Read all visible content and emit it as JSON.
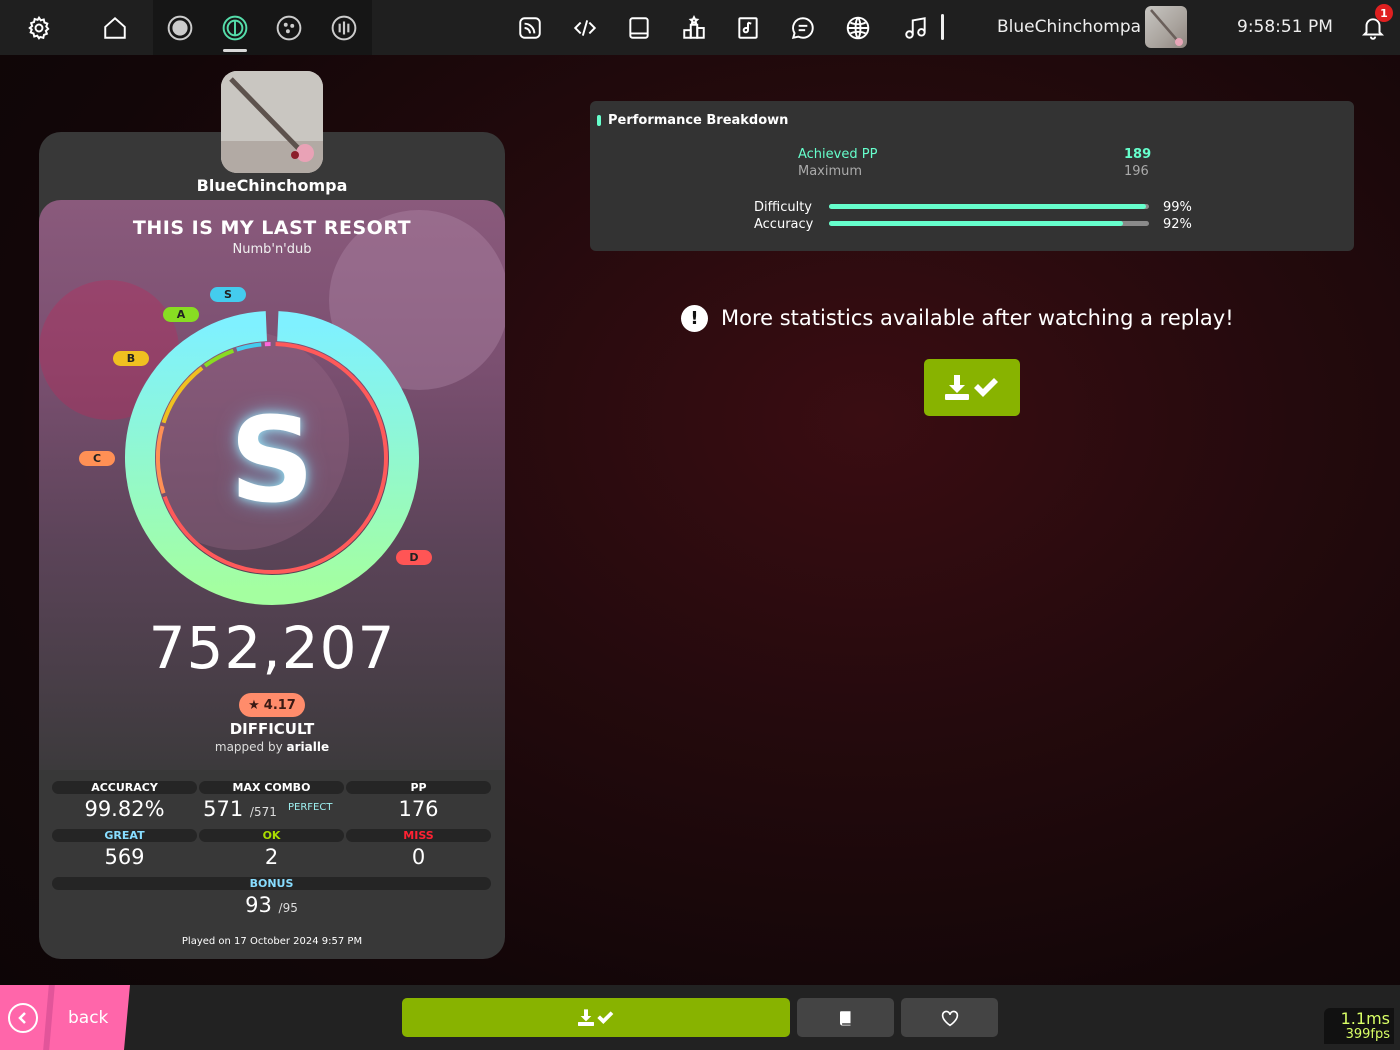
{
  "toolbar": {
    "username": "BlueChinchompa",
    "clock": "9:58:51 PM",
    "notification_count": "1",
    "icons": [
      "settings-icon",
      "home-icon",
      "ruleset-osu-icon",
      "ruleset-taiko-icon",
      "ruleset-catch-icon",
      "ruleset-mania-icon",
      "beatmap-listing-icon",
      "code-icon",
      "wiki-icon",
      "rankings-icon",
      "changelog-icon",
      "chat-icon",
      "dashboard-icon",
      "now-playing-icon",
      "notifications-icon"
    ]
  },
  "score": {
    "username": "BlueChinchompa",
    "title": "THIS IS MY LAST RESORT",
    "artist": "Numb'n'dub",
    "rank": "S",
    "total_score": "752,207",
    "star_rating": "4.17",
    "difficulty": "DIFFICULT",
    "mapped_by_prefix": "mapped by",
    "mapper": "arialle",
    "accuracy_fraction": 0.9982,
    "grade_labels": {
      "s": "S",
      "a": "A",
      "b": "B",
      "c": "C",
      "d": "D"
    },
    "stats": {
      "accuracy": {
        "label": "ACCURACY",
        "value": "99.82%"
      },
      "max_combo": {
        "label": "MAX COMBO",
        "value": "571",
        "max": "/571",
        "tag": "PERFECT"
      },
      "pp": {
        "label": "PP",
        "value": "176"
      },
      "great": {
        "label": "GREAT",
        "value": "569"
      },
      "ok": {
        "label": "OK",
        "value": "2"
      },
      "miss": {
        "label": "MISS",
        "value": "0"
      },
      "bonus": {
        "label": "BONUS",
        "value": "93",
        "max": "/95"
      }
    },
    "played_on": "Played on 17 October 2024 9:57 PM"
  },
  "performance": {
    "title": "Performance Breakdown",
    "achieved_label": "Achieved PP",
    "achieved_value": "189",
    "maximum_label": "Maximum",
    "maximum_value": "196",
    "difficulty_label": "Difficulty",
    "difficulty_value": "99%",
    "difficulty_fraction": 0.99,
    "accuracy_label": "Accuracy",
    "accuracy_value": "92%",
    "accuracy_fraction": 0.92
  },
  "notice": {
    "text": "More statistics available after watching a replay!"
  },
  "bottom": {
    "back_label": "back",
    "frame_time": "1.1ms",
    "fps": "399fps"
  },
  "colors": {
    "accent_green": "#88b300",
    "pp_mint": "#66ffcc",
    "back_pink": "#ff66aa",
    "great_blue": "#88ddff",
    "ok_green": "#aadd00",
    "miss_red": "#ff2233",
    "star_badge": "#ff8c6b"
  }
}
